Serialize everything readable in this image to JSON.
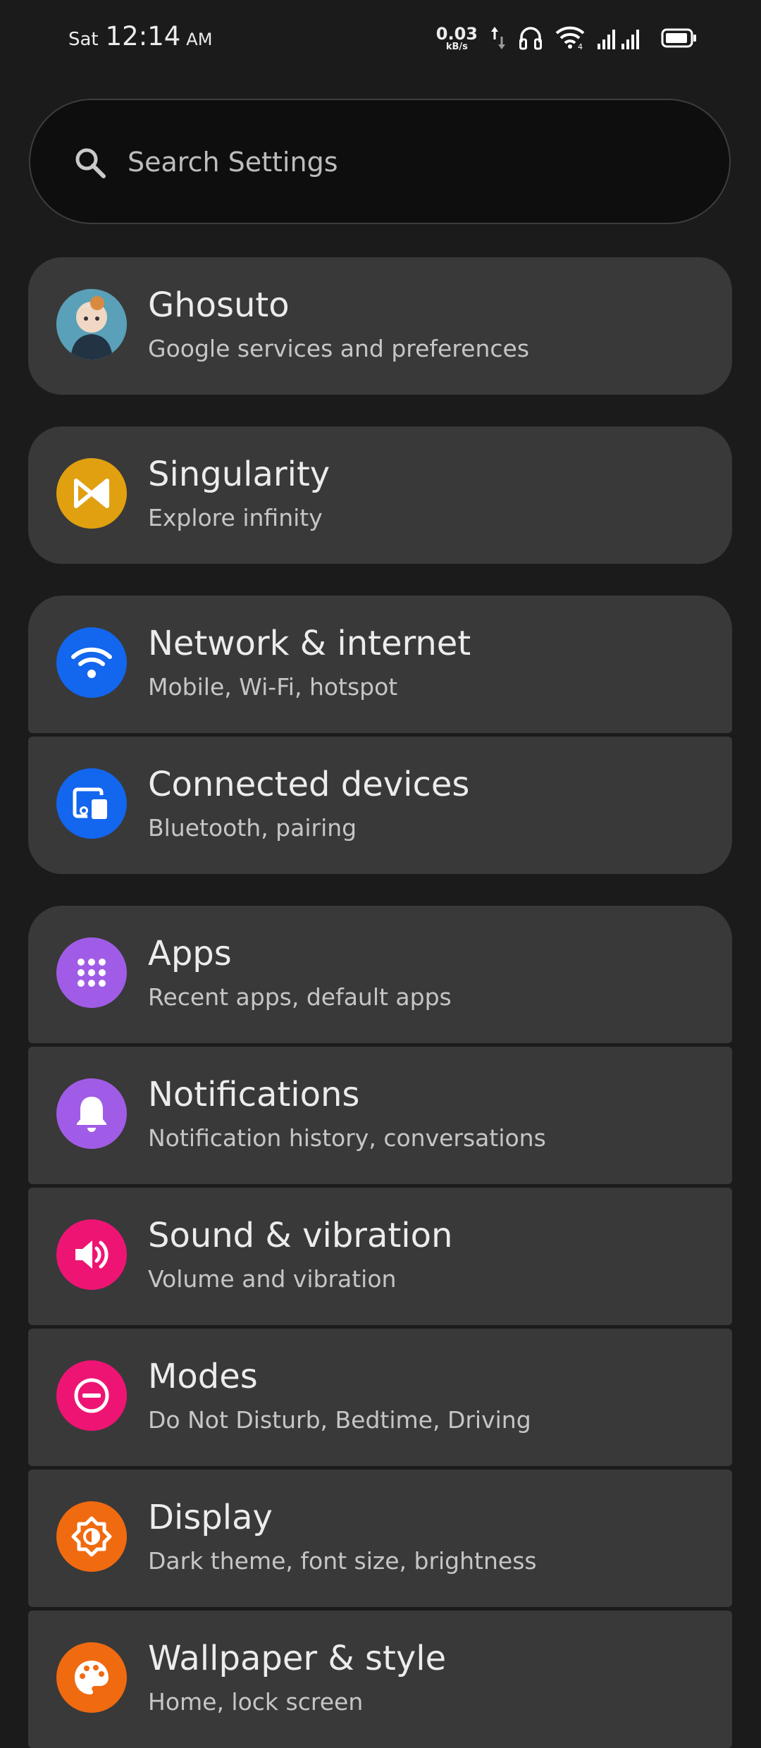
{
  "status_bar": {
    "day": "Sat",
    "time": "12:14",
    "ampm": "AM",
    "net_speed": "0.03",
    "net_unit": "kB/s",
    "icons": [
      "arrows-updown-icon",
      "headphones-icon",
      "wifi-icon",
      "signal-icon",
      "battery-icon"
    ]
  },
  "search": {
    "placeholder": "Search Settings"
  },
  "items": [
    {
      "title": "Ghosuto",
      "subtitle": "Google services and preferences",
      "icon": "avatar",
      "color": "#4a8aa0"
    },
    {
      "title": "Singularity",
      "subtitle": "Explore infinity",
      "icon": "singularity-icon",
      "color": "#e0a010"
    },
    {
      "title": "Network & internet",
      "subtitle": "Mobile, Wi-Fi, hotspot",
      "icon": "wifi-icon",
      "color": "#1366ee"
    },
    {
      "title": "Connected devices",
      "subtitle": "Bluetooth, pairing",
      "icon": "devices-icon",
      "color": "#1366ee"
    },
    {
      "title": "Apps",
      "subtitle": "Recent apps, default apps",
      "icon": "apps-grid-icon",
      "color": "#a05ce6"
    },
    {
      "title": "Notifications",
      "subtitle": "Notification history, conversations",
      "icon": "bell-icon",
      "color": "#a05ce6"
    },
    {
      "title": "Sound & vibration",
      "subtitle": "Volume and vibration",
      "icon": "speaker-icon",
      "color": "#ee1474"
    },
    {
      "title": "Modes",
      "subtitle": "Do Not Disturb, Bedtime, Driving",
      "icon": "do-not-disturb-icon",
      "color": "#ee1474"
    },
    {
      "title": "Display",
      "subtitle": "Dark theme, font size, brightness",
      "icon": "brightness-icon",
      "color": "#f06a10"
    },
    {
      "title": "Wallpaper & style",
      "subtitle": "Home, lock screen",
      "icon": "palette-icon",
      "color": "#f06a10"
    }
  ]
}
